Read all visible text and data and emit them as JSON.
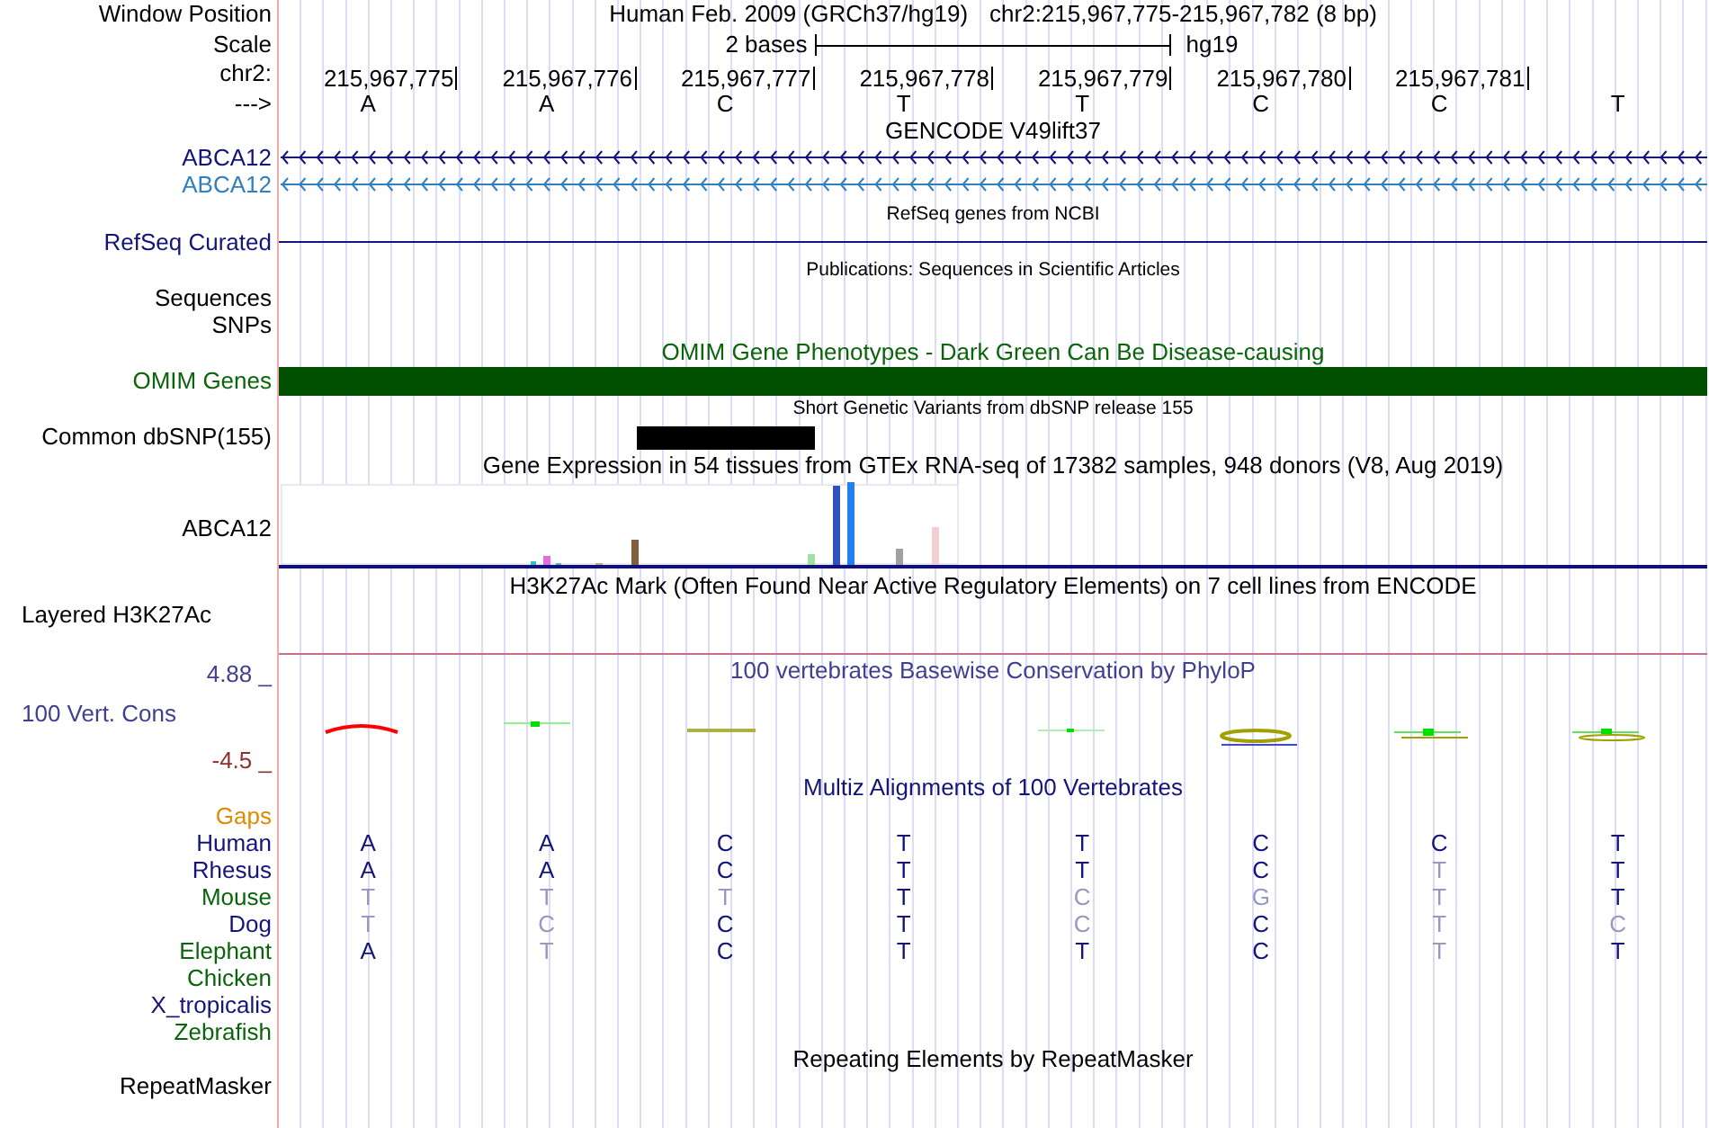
{
  "header": {
    "label": "Window Position",
    "assembly": "Human Feb. 2009 (GRCh37/hg19)",
    "position": "chr2:215,967,775-215,967,782 (8 bp)"
  },
  "scale": {
    "label": "Scale",
    "span": "2 bases",
    "db": "hg19"
  },
  "ruler": {
    "label": "chr2:",
    "ticks": [
      "215,967,775",
      "215,967,776",
      "215,967,777",
      "215,967,778",
      "215,967,779",
      "215,967,780",
      "215,967,781"
    ]
  },
  "sequence": {
    "label": "--->",
    "bases": [
      "A",
      "A",
      "C",
      "T",
      "T",
      "C",
      "C",
      "T"
    ]
  },
  "gencode": {
    "title": "GENCODE V49lift37",
    "genes": [
      {
        "label": "ABCA12",
        "color": "#14147a"
      },
      {
        "label": "ABCA12",
        "color": "#3080c0"
      }
    ]
  },
  "refseq": {
    "title": "RefSeq genes from NCBI",
    "label": "RefSeq Curated"
  },
  "publications": {
    "title": "Publications: Sequences in Scientific Articles",
    "labels": [
      "Sequences",
      "SNPs"
    ]
  },
  "omim": {
    "title": "OMIM Gene Phenotypes - Dark Green Can Be Disease-causing",
    "label": "OMIM Genes"
  },
  "dbsnp": {
    "title": "Short Genetic Variants from dbSNP release 155",
    "label": "Common dbSNP(155)"
  },
  "gtex": {
    "title": "Gene Expression in 54 tissues from GTEx RNA-seq of 17382 samples, 948 donors (V8, Aug 2019)",
    "label": "ABCA12"
  },
  "h3k27ac": {
    "title": "H3K27Ac Mark (Often Found Near Active Regulatory Elements) on 7 cell lines from ENCODE",
    "label": "Layered H3K27Ac"
  },
  "phylop": {
    "title": "100 vertebrates Basewise Conservation by PhyloP",
    "label": "100 Vert. Cons",
    "max": "4.88 _",
    "min": "-4.5 _"
  },
  "multiz": {
    "title": "Multiz Alignments of 100 Vertebrates",
    "gaps": "Gaps",
    "species": [
      {
        "name": "Human",
        "color": "#14147a",
        "bases": [
          {
            "base": "A",
            "conserved": true
          },
          {
            "base": "A",
            "conserved": true
          },
          {
            "base": "C",
            "conserved": true
          },
          {
            "base": "T",
            "conserved": true
          },
          {
            "base": "T",
            "conserved": true
          },
          {
            "base": "C",
            "conserved": true
          },
          {
            "base": "C",
            "conserved": true
          },
          {
            "base": "T",
            "conserved": true
          }
        ]
      },
      {
        "name": "Rhesus",
        "color": "#14147a",
        "bases": [
          {
            "base": "A",
            "conserved": true
          },
          {
            "base": "A",
            "conserved": true
          },
          {
            "base": "C",
            "conserved": true
          },
          {
            "base": "T",
            "conserved": true
          },
          {
            "base": "T",
            "conserved": true
          },
          {
            "base": "C",
            "conserved": true
          },
          {
            "base": "T",
            "conserved": false
          },
          {
            "base": "T",
            "conserved": true
          }
        ]
      },
      {
        "name": "Mouse",
        "color": "#0a640a",
        "bases": [
          {
            "base": "T",
            "conserved": false
          },
          {
            "base": "T",
            "conserved": false
          },
          {
            "base": "T",
            "conserved": false
          },
          {
            "base": "T",
            "conserved": true
          },
          {
            "base": "C",
            "conserved": false
          },
          {
            "base": "G",
            "conserved": false
          },
          {
            "base": "T",
            "conserved": false
          },
          {
            "base": "T",
            "conserved": true
          }
        ]
      },
      {
        "name": "Dog",
        "color": "#14147a",
        "bases": [
          {
            "base": "T",
            "conserved": false
          },
          {
            "base": "C",
            "conserved": false
          },
          {
            "base": "C",
            "conserved": true
          },
          {
            "base": "T",
            "conserved": true
          },
          {
            "base": "C",
            "conserved": false
          },
          {
            "base": "C",
            "conserved": true
          },
          {
            "base": "T",
            "conserved": false
          },
          {
            "base": "C",
            "conserved": false
          }
        ]
      },
      {
        "name": "Elephant",
        "color": "#0a640a",
        "bases": [
          {
            "base": "A",
            "conserved": true
          },
          {
            "base": "T",
            "conserved": false
          },
          {
            "base": "C",
            "conserved": true
          },
          {
            "base": "T",
            "conserved": true
          },
          {
            "base": "T",
            "conserved": true
          },
          {
            "base": "C",
            "conserved": true
          },
          {
            "base": "T",
            "conserved": false
          },
          {
            "base": "T",
            "conserved": true
          }
        ]
      },
      {
        "name": "Chicken",
        "color": "#0a640a"
      },
      {
        "name": "X_tropicalis",
        "color": "#14147a"
      },
      {
        "name": "Zebrafish",
        "color": "#0a640a"
      }
    ]
  },
  "repeatmasker": {
    "title": "Repeating Elements by RepeatMasker",
    "label": "RepeatMasker"
  }
}
